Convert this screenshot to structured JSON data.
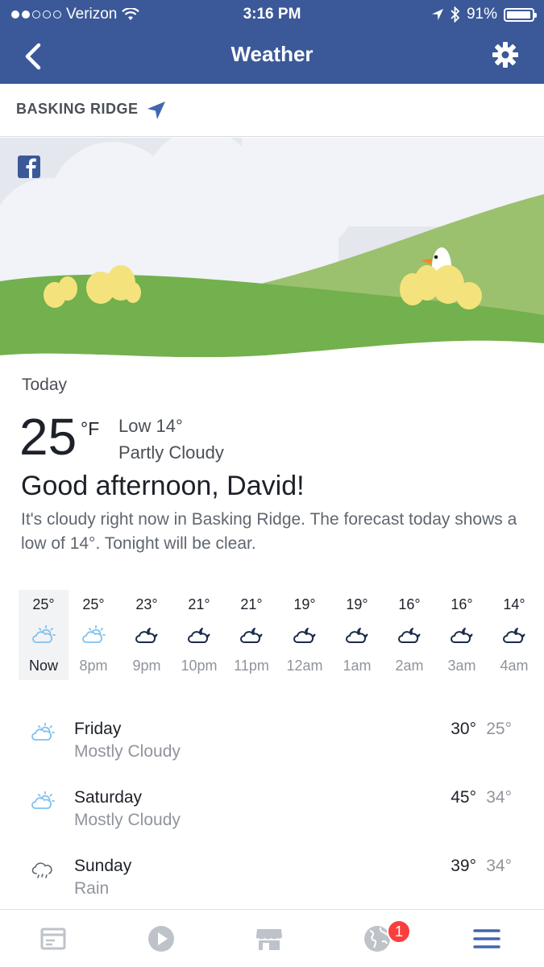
{
  "status_bar": {
    "carrier": "Verizon",
    "time": "3:16 PM",
    "battery": "91%",
    "battery_level": 0.91,
    "signal_bars_filled": 2,
    "signal_bars_total": 5
  },
  "nav": {
    "title": "Weather",
    "back_icon": "chevron-left-icon",
    "settings_icon": "gear-icon",
    "bar_color": "#3b5998"
  },
  "location": {
    "name": "BASKING RIDGE",
    "icon": "location-arrow-icon"
  },
  "today": {
    "label": "Today",
    "temp": "25",
    "unit": "°F",
    "low": "Low 14°",
    "condition": "Partly Cloudy",
    "greeting": "Good afternoon, David!",
    "summary": "It's cloudy right now in Basking Ridge. The forecast today shows a low of 14°. Tonight will be clear."
  },
  "hourly": [
    {
      "temp": "25°",
      "time": "Now",
      "icon": "partly-sunny-icon"
    },
    {
      "temp": "25°",
      "time": "8pm",
      "icon": "partly-sunny-icon"
    },
    {
      "temp": "23°",
      "time": "9pm",
      "icon": "cloudy-night-icon"
    },
    {
      "temp": "21°",
      "time": "10pm",
      "icon": "cloudy-night-icon"
    },
    {
      "temp": "21°",
      "time": "11pm",
      "icon": "cloudy-night-icon"
    },
    {
      "temp": "19°",
      "time": "12am",
      "icon": "cloudy-night-icon"
    },
    {
      "temp": "19°",
      "time": "1am",
      "icon": "cloudy-night-icon"
    },
    {
      "temp": "16°",
      "time": "2am",
      "icon": "cloudy-night-icon"
    },
    {
      "temp": "16°",
      "time": "3am",
      "icon": "cloudy-night-icon"
    },
    {
      "temp": "14°",
      "time": "4am",
      "icon": "cloudy-night-icon"
    }
  ],
  "daily": [
    {
      "day": "Friday",
      "condition": "Mostly Cloudy",
      "high": "30°",
      "low": "25°",
      "icon": "partly-sunny-icon"
    },
    {
      "day": "Saturday",
      "condition": "Mostly Cloudy",
      "high": "45°",
      "low": "34°",
      "icon": "partly-sunny-icon"
    },
    {
      "day": "Sunday",
      "condition": "Rain",
      "high": "39°",
      "low": "34°",
      "icon": "rain-cloud-icon"
    }
  ],
  "tabbar": {
    "tabs": [
      {
        "name": "news-feed-tab",
        "icon": "news-feed-icon"
      },
      {
        "name": "video-tab",
        "icon": "play-icon"
      },
      {
        "name": "marketplace-tab",
        "icon": "store-icon"
      },
      {
        "name": "notifications-tab",
        "icon": "globe-icon"
      },
      {
        "name": "menu-tab",
        "icon": "hamburger-menu-icon"
      }
    ],
    "notification_count": "1",
    "active_color": "#4267b2"
  }
}
